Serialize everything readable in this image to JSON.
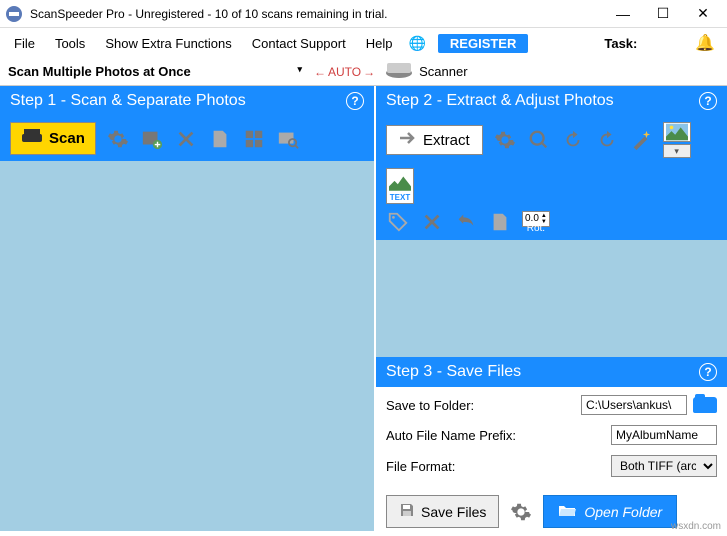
{
  "titlebar": {
    "title": "ScanSpeeder Pro - Unregistered - 10 of 10 scans remaining in trial."
  },
  "menu": {
    "file": "File",
    "tools": "Tools",
    "extra": "Show Extra Functions",
    "contact": "Contact Support",
    "help": "Help",
    "register": "REGISTER",
    "task": "Task:"
  },
  "subbar": {
    "mode": "Scan Multiple Photos at Once",
    "auto": "AUTO",
    "scanner": "Scanner"
  },
  "step1": {
    "title": "Step 1 - Scan & Separate Photos",
    "scan": "Scan"
  },
  "step2": {
    "title": "Step 2 - Extract & Adjust Photos",
    "extract": "Extract",
    "zoom": "0.0",
    "rot": "Rot."
  },
  "step3": {
    "title": "Step 3 - Save Files",
    "saveToFolder": "Save to Folder:",
    "folderValue": "C:\\Users\\ankus\\",
    "prefix": "Auto File Name Prefix:",
    "prefixValue": "MyAlbumName",
    "format": "File Format:",
    "formatValue": "Both TIFF (archival",
    "saveFiles": "Save Files",
    "openFolder": "Open Folder"
  },
  "watermark": "wsxdn.com"
}
